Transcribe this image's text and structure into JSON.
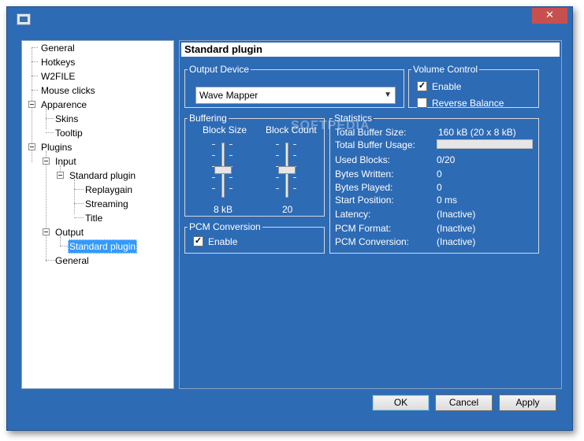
{
  "window": {
    "close_glyph": "✕"
  },
  "tree": {
    "items": [
      {
        "label": "General"
      },
      {
        "label": "Hotkeys"
      },
      {
        "label": "W2FILE"
      },
      {
        "label": "Mouse clicks"
      },
      {
        "label": "Apparence"
      },
      {
        "label": "Skins"
      },
      {
        "label": "Tooltip"
      },
      {
        "label": "Plugins"
      },
      {
        "label": "Input"
      },
      {
        "label": "Standard plugin"
      },
      {
        "label": "Replaygain"
      },
      {
        "label": "Streaming"
      },
      {
        "label": "Title"
      },
      {
        "label": "Output"
      },
      {
        "label": "Standard plugin"
      },
      {
        "label": "General"
      }
    ],
    "selected_index": 14
  },
  "panel": {
    "title": "Standard plugin",
    "output_device": {
      "legend": "Output Device",
      "selected": "Wave Mapper"
    },
    "volume_control": {
      "legend": "Volume Control",
      "enable_label": "Enable",
      "enable_checked": true,
      "reverse_balance_label": "Reverse Balance",
      "reverse_balance_checked": false
    },
    "buffering": {
      "legend": "Buffering",
      "block_size_label": "Block Size",
      "block_count_label": "Block Count",
      "block_size_value": "8 kB",
      "block_count_value": "20"
    },
    "pcm_conversion": {
      "legend": "PCM Conversion",
      "enable_label": "Enable",
      "enable_checked": true
    },
    "statistics": {
      "legend": "Statistics",
      "rows": [
        {
          "label": "Total Buffer Size:",
          "value": "160 kB (20 x 8 kB)"
        },
        {
          "label": "Total Buffer Usage:",
          "value": ""
        },
        {
          "label": "Used Blocks:",
          "value": "0/20"
        },
        {
          "label": "Bytes Written:",
          "value": "0"
        },
        {
          "label": "Bytes Played:",
          "value": "0"
        },
        {
          "label": "Start Position:",
          "value": "0 ms"
        },
        {
          "label": "Latency:",
          "value": "(Inactive)"
        },
        {
          "label": "PCM Format:",
          "value": "(Inactive)"
        },
        {
          "label": "PCM Conversion:",
          "value": "(Inactive)"
        }
      ],
      "buffer_usage_fraction": 0
    }
  },
  "buttons": {
    "ok": "OK",
    "cancel": "Cancel",
    "apply": "Apply"
  },
  "watermark": "SOFTPEDIA",
  "colors": {
    "window_bg": "#2d6bb5",
    "close_button": "#c7504f",
    "selection": "#3399ff"
  }
}
